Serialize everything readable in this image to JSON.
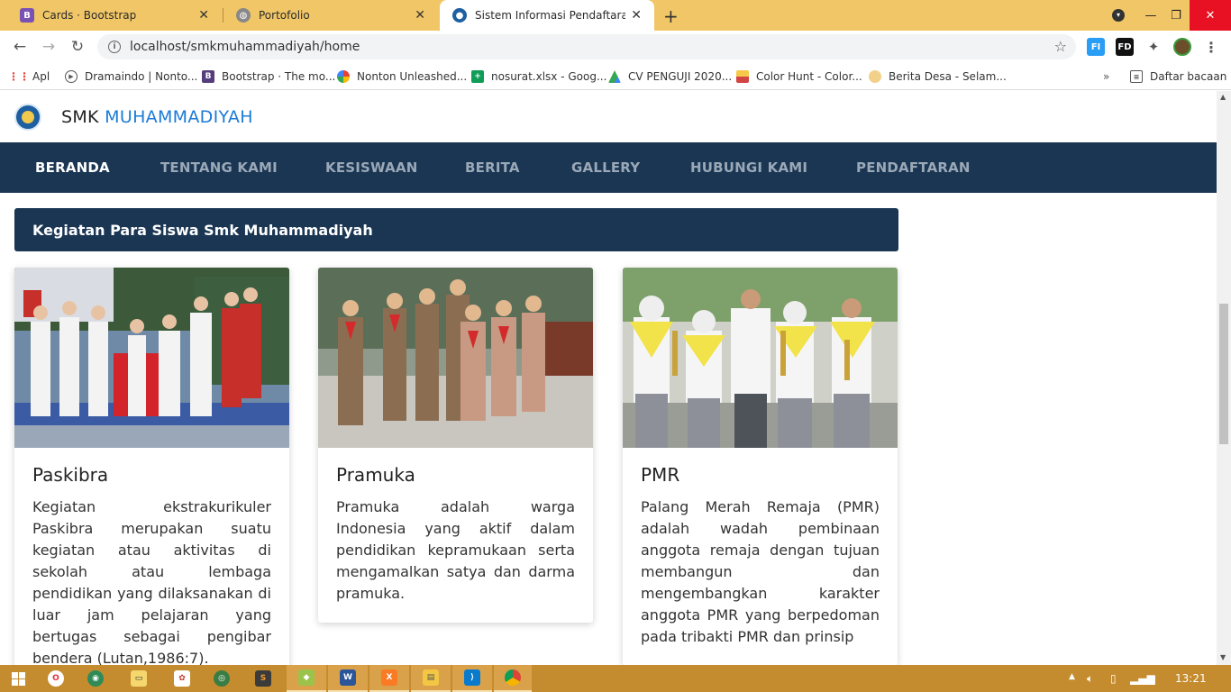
{
  "browser": {
    "tabs": [
      {
        "title": "Cards · Bootstrap",
        "favicon": "B",
        "active": false
      },
      {
        "title": "Portofolio",
        "favicon": "globe",
        "active": false
      },
      {
        "title": "Sistem Informasi Pendaftaran Sis",
        "favicon": "tutwuri",
        "active": true
      }
    ],
    "url": "localhost/smkmuhammadiyah/home",
    "bookmarks": [
      {
        "label": "Apl",
        "icon": "apps-grid-icon"
      },
      {
        "label": "Dramaindo | Nonto...",
        "icon": "play-icon"
      },
      {
        "label": "Bootstrap · The mo...",
        "icon": "bootstrap-icon"
      },
      {
        "label": "Nonton Unleashed...",
        "icon": "pinwheel-icon"
      },
      {
        "label": "nosurat.xlsx - Goog...",
        "icon": "sheets-icon"
      },
      {
        "label": "CV PENGUJI 2020...",
        "icon": "drive-icon"
      },
      {
        "label": "Color Hunt - Color...",
        "icon": "colorhunt-icon"
      },
      {
        "label": "Berita Desa - Selam...",
        "icon": "news-icon"
      }
    ],
    "reading_list": "Daftar bacaan"
  },
  "site": {
    "brand_main": "SMK",
    "brand_highlight": "MUHAMMADIYAH",
    "nav": [
      "BERANDA",
      "TENTANG KAMI",
      "KESISWAAN",
      "BERITA",
      "GALLERY",
      "HUBUNGI KAMI",
      "PENDAFTARAN"
    ],
    "active_nav": "BERANDA",
    "section_title": "Kegiatan Para Siswa Smk Muhammadiyah",
    "cards": [
      {
        "title": "Paskibra",
        "text": "Kegiatan ekstrakurikuler Paskibra merupakan suatu kegiatan atau aktivitas di sekolah atau lembaga pendidikan yang dilaksanakan di luar jam pelajaran yang bertugas sebagai pengibar bendera (Lutan,1986:7)."
      },
      {
        "title": "Pramuka",
        "text": "Pramuka adalah warga Indonesia yang aktif dalam pendidikan kepramukaan serta mengamalkan satya dan darma pramuka."
      },
      {
        "title": "PMR",
        "text": "Palang Merah Remaja (PMR) adalah wadah pembinaan anggota remaja dengan tujuan membangun dan mengembangkan karakter anggota PMR yang berpedoman pada tribakti PMR dan prinsip"
      }
    ]
  },
  "taskbar": {
    "clock": "13:21"
  },
  "colors": {
    "nav_bg": "#1a3653",
    "brand_highlight": "#1c7bd6",
    "tabstrip": "#f1c667",
    "taskbar": "#c58c2f"
  }
}
